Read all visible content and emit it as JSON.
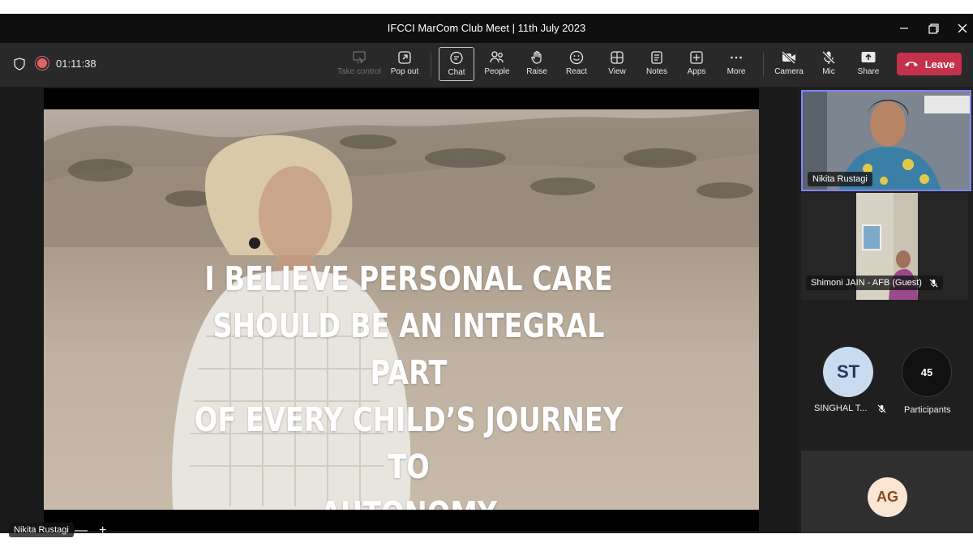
{
  "window": {
    "title": "IFCCI MarCom Club Meet | 11th July 2023"
  },
  "toolbar": {
    "timer": "01:11:38",
    "buttons": [
      {
        "label": "Take control",
        "icon": "take-control-icon"
      },
      {
        "label": "Pop out",
        "icon": "pop-out-icon"
      },
      {
        "label": "Chat",
        "icon": "chat-icon"
      },
      {
        "label": "People",
        "icon": "people-icon"
      },
      {
        "label": "Raise",
        "icon": "raise-hand-icon"
      },
      {
        "label": "React",
        "icon": "react-icon"
      },
      {
        "label": "View",
        "icon": "view-icon"
      },
      {
        "label": "Notes",
        "icon": "notes-icon"
      },
      {
        "label": "Apps",
        "icon": "apps-icon"
      },
      {
        "label": "More",
        "icon": "more-icon"
      },
      {
        "label": "Camera",
        "icon": "camera-off-icon"
      },
      {
        "label": "Mic",
        "icon": "mic-off-icon"
      },
      {
        "label": "Share",
        "icon": "share-icon"
      }
    ],
    "leave_label": "Leave",
    "leave_color": "#c4314b"
  },
  "stage": {
    "slide_lines": [
      "I BELIEVE PERSONAL CARE",
      "SHOULD BE AN INTEGRAL PART",
      "OF EVERY CHILD’S JOURNEY TO",
      "AUTONOMY"
    ],
    "presenter": "Nikita Rustagi",
    "zoom_out": "—",
    "zoom_in": "+"
  },
  "participants": {
    "tile1_name": "Nikita Rustagi",
    "tile2_name": "Shimoni JAIN - AFB (Guest)",
    "st_initials": "ST",
    "st_name": "SINGHAL T...",
    "count": "45",
    "count_label": "Participants",
    "ag_initials": "AG",
    "highlight_color": "#7f85f5"
  }
}
